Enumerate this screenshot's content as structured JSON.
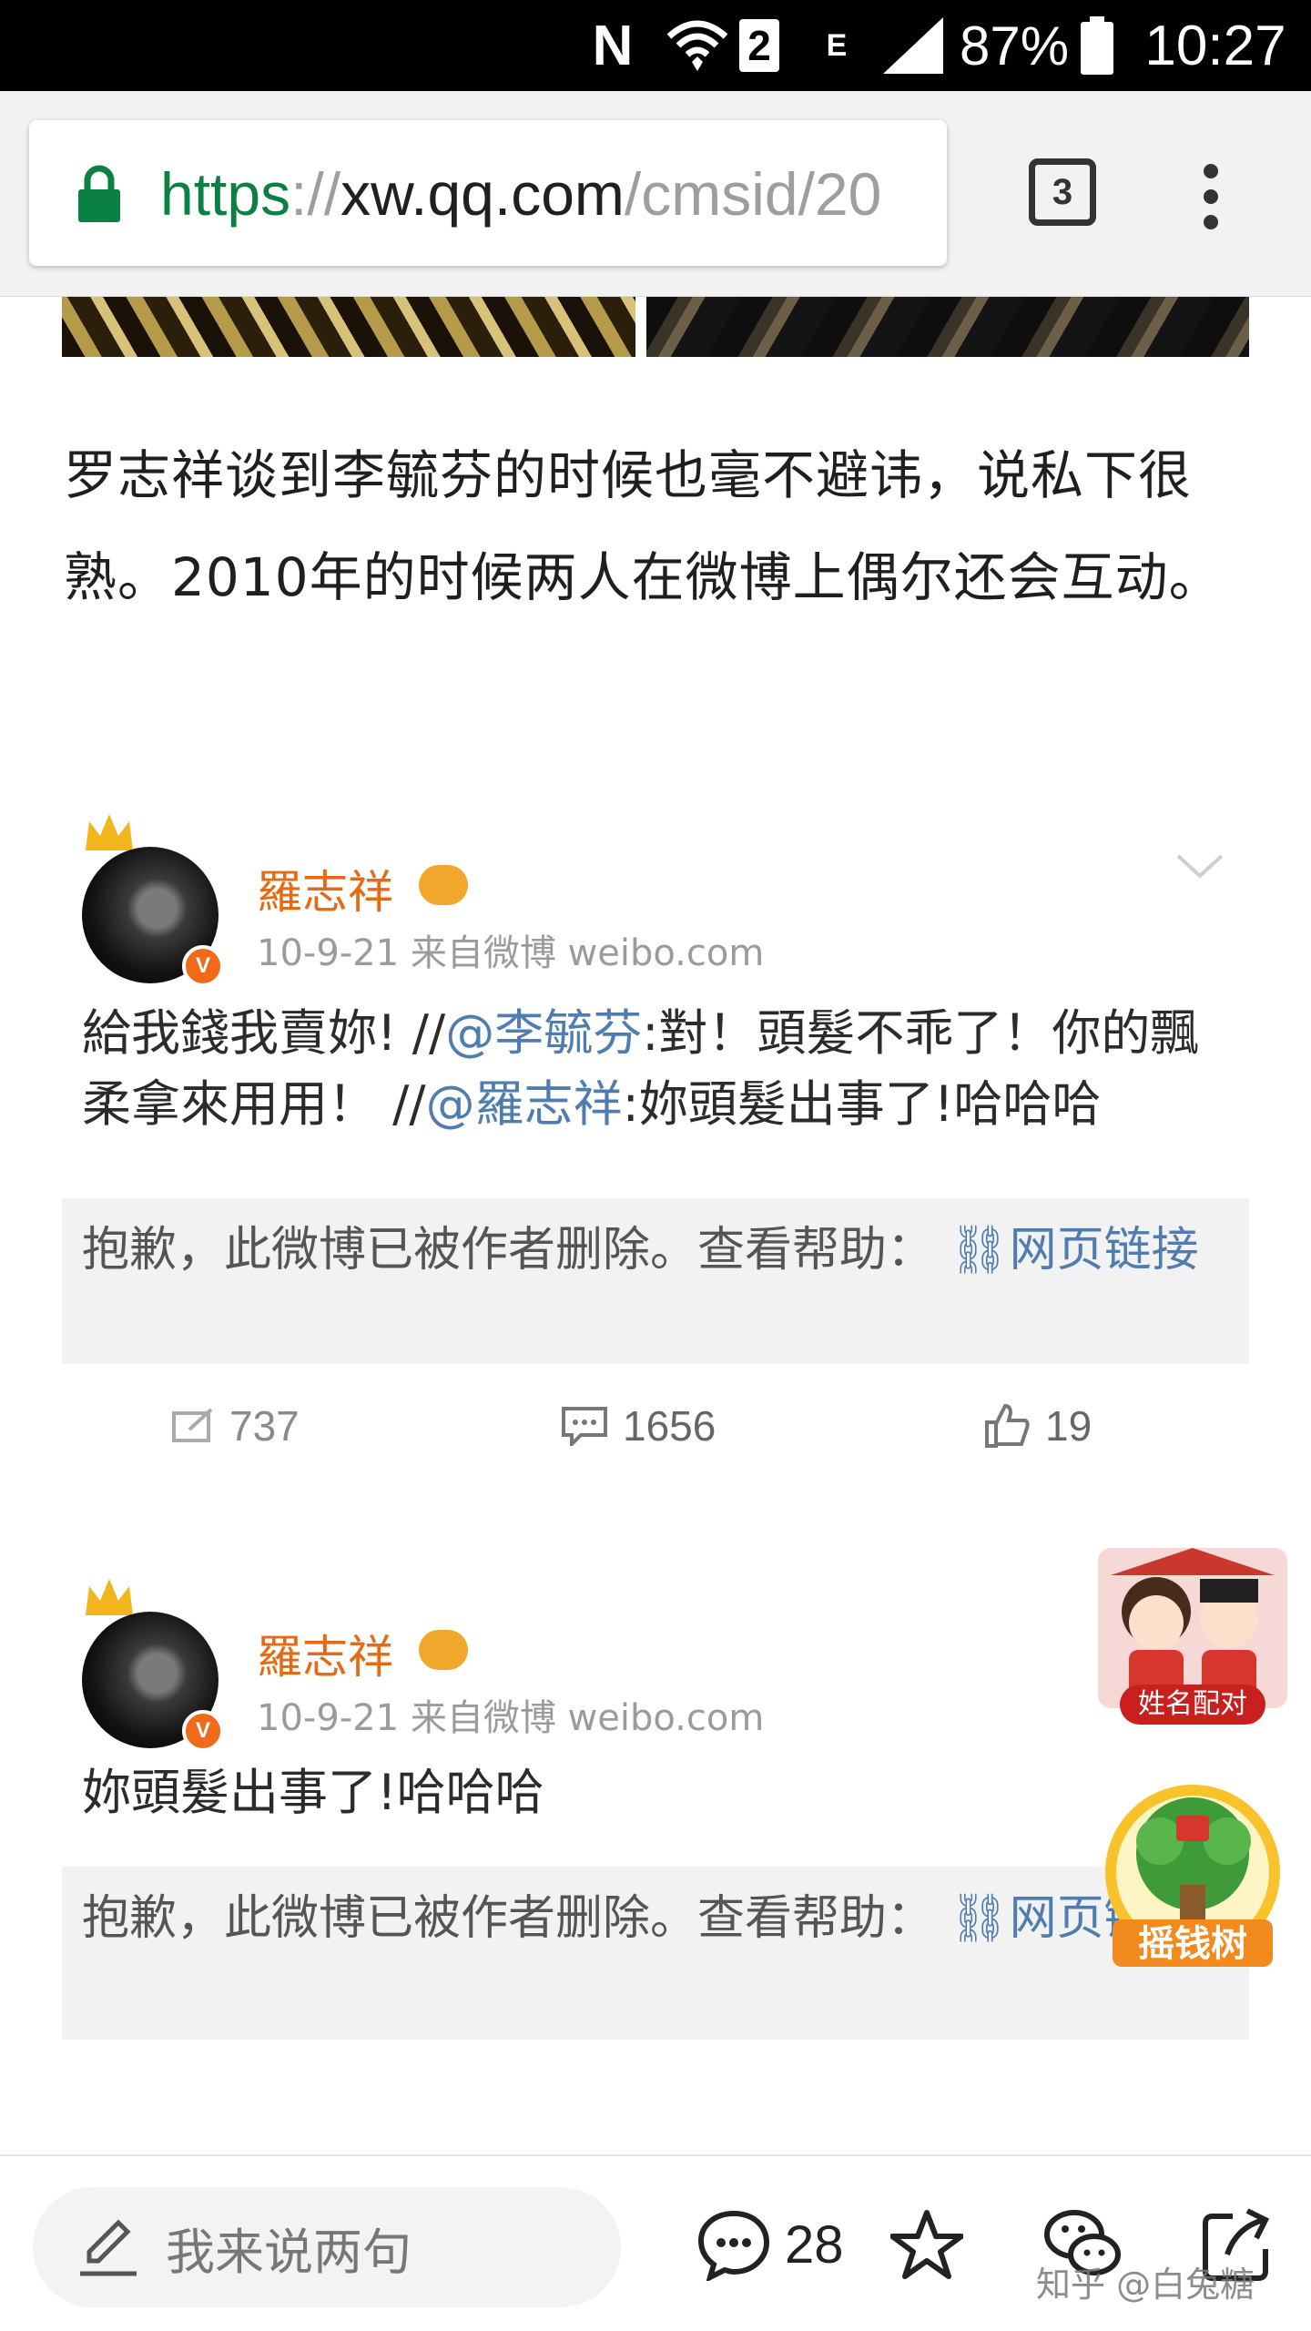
{
  "status_bar": {
    "nfc": "N",
    "sim": "2",
    "network": "E",
    "battery_pct": "87%",
    "time": "10:27"
  },
  "browser": {
    "url_scheme": "https",
    "url_sep": "://",
    "url_host": "xw.qq.com",
    "url_path": "/cmsid/20",
    "tab_count": "3",
    "icons": [
      "lock-icon",
      "tabs-icon",
      "more-vert-icon"
    ]
  },
  "article": {
    "paragraph": "罗志祥谈到李毓芬的时候也毫不避讳，说私下很熟。2010年的时候两人在微博上偶尔还会互动。"
  },
  "weibo_posts": [
    {
      "author": "羅志祥",
      "meta": "10-9-21  来自微博 weibo.com",
      "verified": "V",
      "text_parts": [
        {
          "t": "給我錢我賣妳! //",
          "mention": false
        },
        {
          "t": "@李毓芬",
          "mention": true
        },
        {
          "t": ":對！頭髮不乖了！你的飄柔拿來用用！ //",
          "mention": false
        },
        {
          "t": "@羅志祥",
          "mention": true
        },
        {
          "t": ":妳頭髮出事了!哈哈哈",
          "mention": false
        }
      ],
      "deleted_notice": "抱歉，此微博已被作者删除。查看帮助：",
      "deleted_link": "网页链接",
      "repost_count": "737",
      "comment_count": "1656",
      "like_count": "19"
    },
    {
      "author": "羅志祥",
      "meta": "10-9-21  来自微博 weibo.com",
      "verified": "V",
      "text": "妳頭髮出事了!哈哈哈",
      "deleted_notice": "抱歉，此微博已被作者删除。查看帮助：",
      "deleted_link": "网页链接"
    }
  ],
  "floating_ads": {
    "ad1_label": "姓名配对",
    "ad2_label": "摇钱树"
  },
  "bottom_bar": {
    "comment_placeholder": "我来说两句",
    "comment_count": "28",
    "watermark": "知乎 @白兔糖"
  },
  "colors": {
    "weibo_name": "#e56a13",
    "mention": "#507daf",
    "https_green": "#0b8043"
  }
}
